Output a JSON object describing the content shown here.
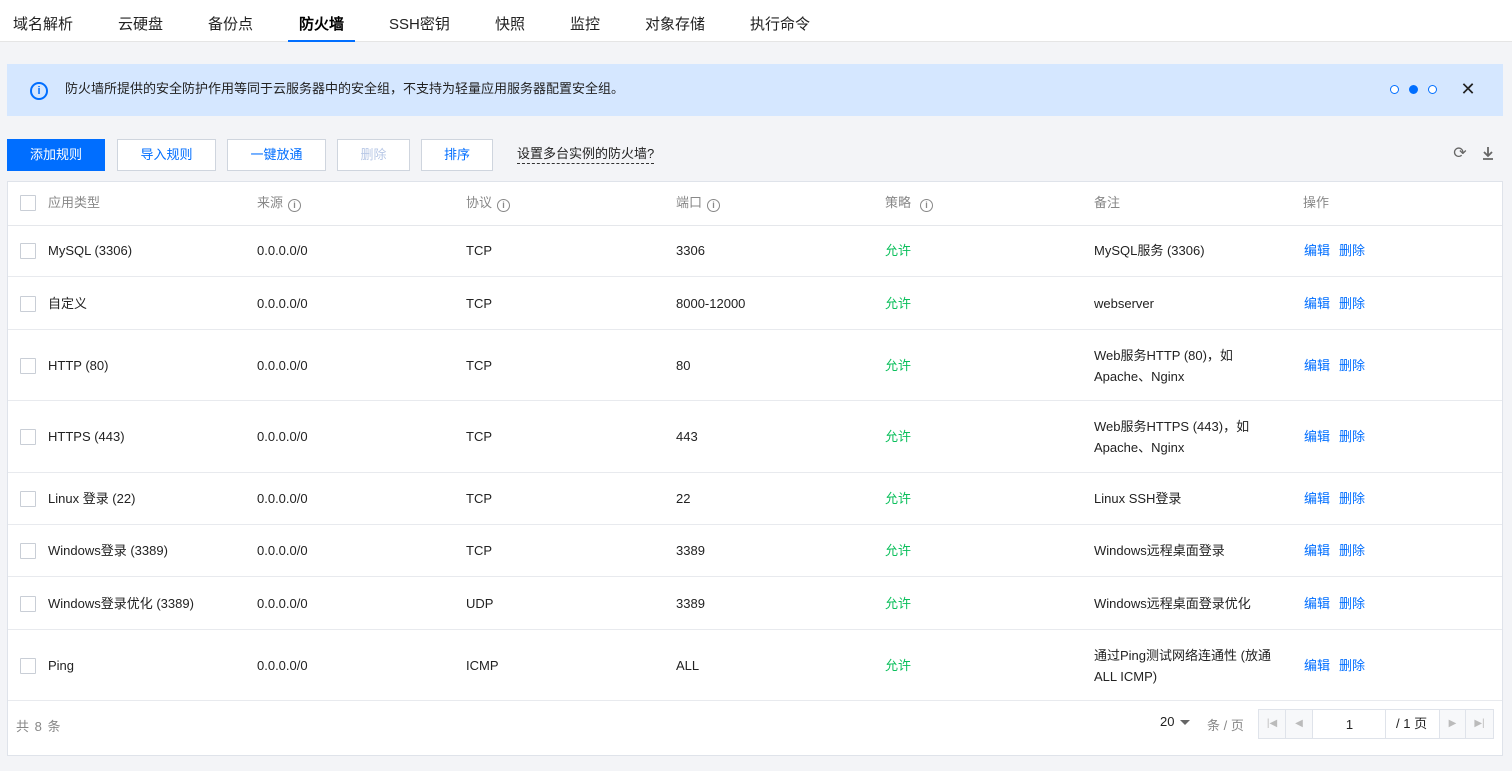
{
  "tabs": [
    {
      "label": "域名解析"
    },
    {
      "label": "云硬盘"
    },
    {
      "label": "备份点"
    },
    {
      "label": "防火墙"
    },
    {
      "label": "SSH密钥"
    },
    {
      "label": "快照"
    },
    {
      "label": "监控"
    },
    {
      "label": "对象存储"
    },
    {
      "label": "执行命令"
    }
  ],
  "active_tab": "防火墙",
  "notice": {
    "icon": "info-icon",
    "text": "防火墙所提供的安全防护作用等同于云服务器中的安全组，不支持为轻量应用服务器配置安全组。",
    "carousel_count": 3,
    "carousel_active": 2
  },
  "toolbar": {
    "add_rule": "添加规则",
    "import_rules": "导入规则",
    "open_all": "一键放通",
    "delete": "删除",
    "sort": "排序",
    "multi_instance_link": "设置多台实例的防火墙?",
    "refresh_icon": "refresh-icon",
    "download_icon": "download-icon"
  },
  "table": {
    "headers": {
      "app_type": "应用类型",
      "source": "来源",
      "protocol": "协议",
      "port": "端口",
      "policy": "策略",
      "remark": "备注",
      "action": "操作"
    },
    "rows": [
      {
        "app_type": "MySQL (3306)",
        "source": "0.0.0.0/0",
        "protocol": "TCP",
        "port": "3306",
        "policy": "允许",
        "remark": [
          "MySQL服务 (3306)"
        ]
      },
      {
        "app_type": "自定义",
        "source": "0.0.0.0/0",
        "protocol": "TCP",
        "port": "8000-12000",
        "policy": "允许",
        "remark": [
          "webserver"
        ]
      },
      {
        "app_type": "HTTP (80)",
        "source": "0.0.0.0/0",
        "protocol": "TCP",
        "port": "80",
        "policy": "允许",
        "remark": [
          "Web服务HTTP (80)，如",
          "Apache、Nginx"
        ]
      },
      {
        "app_type": "HTTPS (443)",
        "source": "0.0.0.0/0",
        "protocol": "TCP",
        "port": "443",
        "policy": "允许",
        "remark": [
          "Web服务HTTPS (443)，如",
          "Apache、Nginx"
        ]
      },
      {
        "app_type": "Linux 登录 (22)",
        "source": "0.0.0.0/0",
        "protocol": "TCP",
        "port": "22",
        "policy": "允许",
        "remark": [
          "Linux SSH登录"
        ]
      },
      {
        "app_type": "Windows登录 (3389)",
        "source": "0.0.0.0/0",
        "protocol": "TCP",
        "port": "3389",
        "policy": "允许",
        "remark": [
          "Windows远程桌面登录"
        ]
      },
      {
        "app_type": "Windows登录优化 (3389)",
        "source": "0.0.0.0/0",
        "protocol": "UDP",
        "port": "3389",
        "policy": "允许",
        "remark": [
          "Windows远程桌面登录优化"
        ]
      },
      {
        "app_type": "Ping",
        "source": "0.0.0.0/0",
        "protocol": "ICMP",
        "port": "ALL",
        "policy": "允许",
        "remark": [
          "通过Ping测试网络连通性 (放通",
          "ALL ICMP)"
        ]
      }
    ],
    "edit_label": "编辑",
    "delete_label": "删除"
  },
  "footer": {
    "total_label": "共 8 条",
    "page_size": "20",
    "per_page_label": "条 / 页",
    "current_page": "1",
    "total_pages_label": "/ 1 页"
  },
  "colors": {
    "accent": "#006eff",
    "allow": "#0abf5b",
    "notice_bg": "#d5e7ff"
  }
}
